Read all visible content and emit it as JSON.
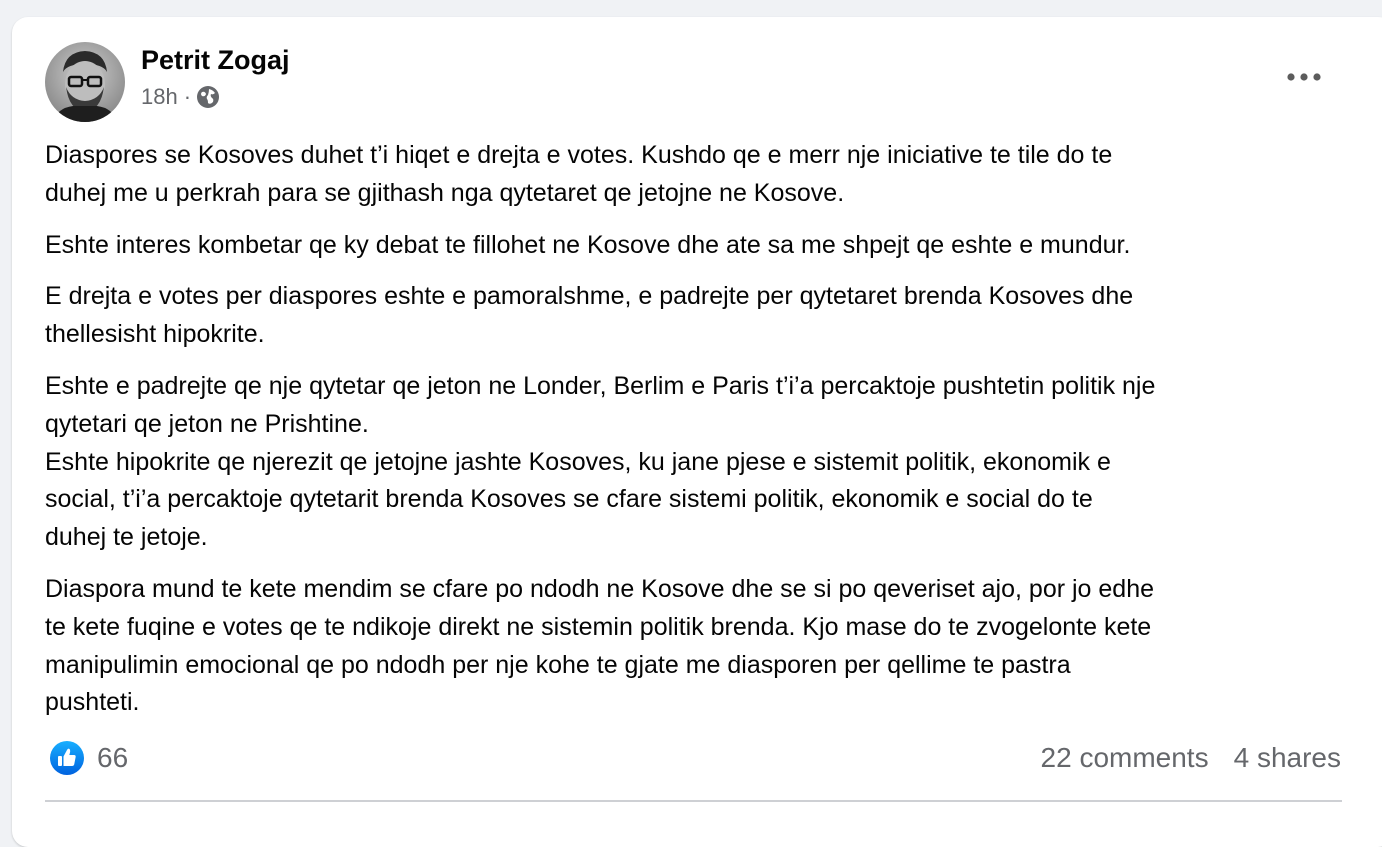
{
  "post": {
    "author": "Petrit Zogaj",
    "time": "18h",
    "separator": "·",
    "privacy_icon": "globe-icon",
    "more_icon": "more-options-icon",
    "body": {
      "p1": [
        "Diaspores se Kosoves duhet t’i hiqet e drejta e votes. Kushdo qe e merr nje iniciative te tile do te",
        "duhej me u perkrah para se gjithash nga qytetaret qe jetojne ne Kosove."
      ],
      "p2": [
        "Eshte interes kombetar qe ky debat te fillohet ne Kosove dhe ate sa me shpejt qe eshte e mundur."
      ],
      "p3": [
        "E drejta e votes per diaspores eshte e pamoralshme, e padrejte per qytetaret brenda Kosoves dhe",
        "thellesisht hipokrite."
      ],
      "p4": [
        "Eshte e padrejte qe nje qytetar qe jeton ne Londer, Berlim e Paris t’i’a percaktoje pushtetin politik nje",
        "qytetari qe jeton ne Prishtine.",
        "Eshte hipokrite qe njerezit qe jetojne jashte Kosoves, ku jane pjese e sistemit politik, ekonomik e",
        "social, t’i’a percaktoje qytetarit brenda Kosoves se cfare sistemi politik, ekonomik e social do te",
        "duhej te jetoje."
      ],
      "p5": [
        "Diaspora mund te kete mendim se cfare po ndodh ne Kosove dhe se si po qeveriset ajo, por jo edhe",
        "te kete fuqine e votes qe te ndikoje direkt ne sistemin politik brenda. Kjo mase do te zvogelonte kete",
        "manipulimin emocional qe po ndodh per nje kohe te gjate me diasporen per qellime te pastra",
        "pushteti."
      ]
    },
    "reactions": {
      "icon": "like-icon",
      "count": "66",
      "color": "#1877f2"
    },
    "comments": "22 comments",
    "shares": "4 shares"
  }
}
